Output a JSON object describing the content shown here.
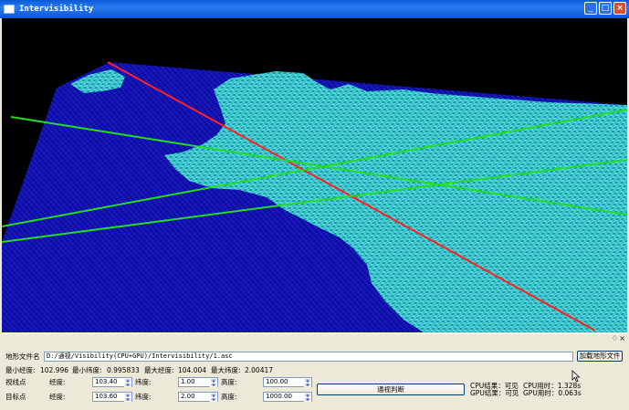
{
  "window": {
    "title": "Intervisibility"
  },
  "title_buttons": {
    "minimize": "_",
    "maximize": "□",
    "close": "×"
  },
  "dock": {
    "float_glyph": "♢",
    "close_glyph": "×"
  },
  "terrain": {
    "water_color": "#0a0a9e",
    "land_color": "#33d6d6",
    "sight_line_color": "#ff2020",
    "helper_line_color": "#22dd22"
  },
  "file": {
    "label": "地形文件名",
    "path": "D:/通视/Visibility(CPU+GPU)/Intervisibility/1.asc",
    "load_button": "加载地形文件"
  },
  "bounds": {
    "min_lon_label": "最小经度:",
    "min_lon": "102.996",
    "min_lat_label": "最小纬度:",
    "min_lat": "0.995833",
    "max_lon_label": "最大经度:",
    "max_lon": "104.004",
    "max_lat_label": "最大纬度:",
    "max_lat": "2.00417"
  },
  "viewpoint": {
    "label": "视线点",
    "lon_label": "经度:",
    "lon": "103.40",
    "lat_label": "纬度:",
    "lat": "1.00",
    "height_label": "高度:",
    "height": "100.00"
  },
  "target": {
    "label": "目标点",
    "lon_label": "经度:",
    "lon": "103.60",
    "lat_label": "纬度:",
    "lat": "2.00",
    "height_label": "高度:",
    "height": "1000.00"
  },
  "judge_button": "通视判断",
  "results": {
    "cpu_result": "CPU结果：可见",
    "gpu_result": "GPU结果：可见",
    "cpu_time": "CPU用时：1.328s",
    "gpu_time": "GPU用时：0.063s"
  }
}
